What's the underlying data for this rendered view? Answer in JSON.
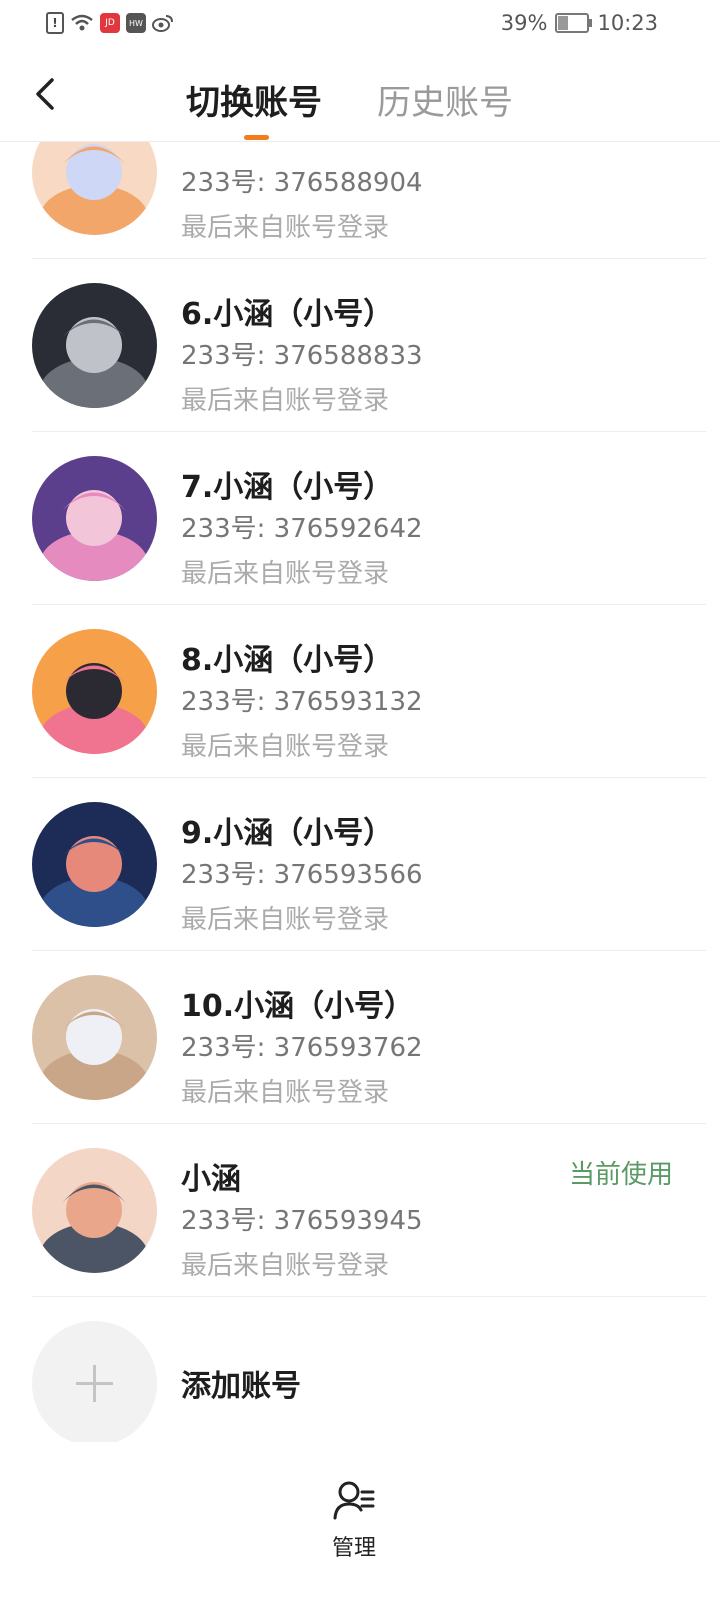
{
  "status_bar": {
    "battery": "39%",
    "battery_level": 0.39,
    "time": "10:23",
    "notification_icons": [
      "alert-icon",
      "wifi-icon",
      "app-icon-jd",
      "app-icon-huawei",
      "weibo-icon"
    ]
  },
  "header": {
    "tabs": [
      {
        "label": "切换账号",
        "active": true
      },
      {
        "label": "历史账号",
        "active": false
      }
    ],
    "accent_color": "#f07e1a"
  },
  "accounts": [
    {
      "name": "",
      "id_text": "233号: 376588904",
      "source": "最后来自账号登录",
      "current": false,
      "avatar_colors": [
        "#f7d9c4",
        "#f3a66a",
        "#cfd7f6"
      ]
    },
    {
      "name": "6.小涵（小号）",
      "id_text": "233号: 376588833",
      "source": "最后来自账号登录",
      "current": false,
      "avatar_colors": [
        "#2a2d35",
        "#6b6f78",
        "#bfc3c9"
      ]
    },
    {
      "name": "7.小涵（小号）",
      "id_text": "233号: 376592642",
      "source": "最后来自账号登录",
      "current": false,
      "avatar_colors": [
        "#5b3e8c",
        "#e58bc0",
        "#f2c6d8"
      ]
    },
    {
      "name": "8.小涵（小号）",
      "id_text": "233号: 376593132",
      "source": "最后来自账号登录",
      "current": false,
      "avatar_colors": [
        "#f6a04a",
        "#f0738f",
        "#2b2a33"
      ]
    },
    {
      "name": "9.小涵（小号）",
      "id_text": "233号: 376593566",
      "source": "最后来自账号登录",
      "current": false,
      "avatar_colors": [
        "#1d2c57",
        "#2f4f8a",
        "#e7897a"
      ]
    },
    {
      "name": "10.小涵（小号）",
      "id_text": "233号: 376593762",
      "source": "最后来自账号登录",
      "current": false,
      "avatar_colors": [
        "#dcc1a9",
        "#c9a687",
        "#eef0f6"
      ]
    },
    {
      "name": "小涵",
      "id_text": "233号: 376593945",
      "source": "最后来自账号登录",
      "current": true,
      "avatar_colors": [
        "#f4d6c7",
        "#4c5566",
        "#e9a68a"
      ]
    }
  ],
  "current_label": "当前使用",
  "current_color": "#5a9a66",
  "add_account": {
    "label": "添加账号",
    "icon": "plus-icon"
  },
  "bottom": {
    "manage_label": "管理",
    "manage_icon": "user-list-icon"
  }
}
